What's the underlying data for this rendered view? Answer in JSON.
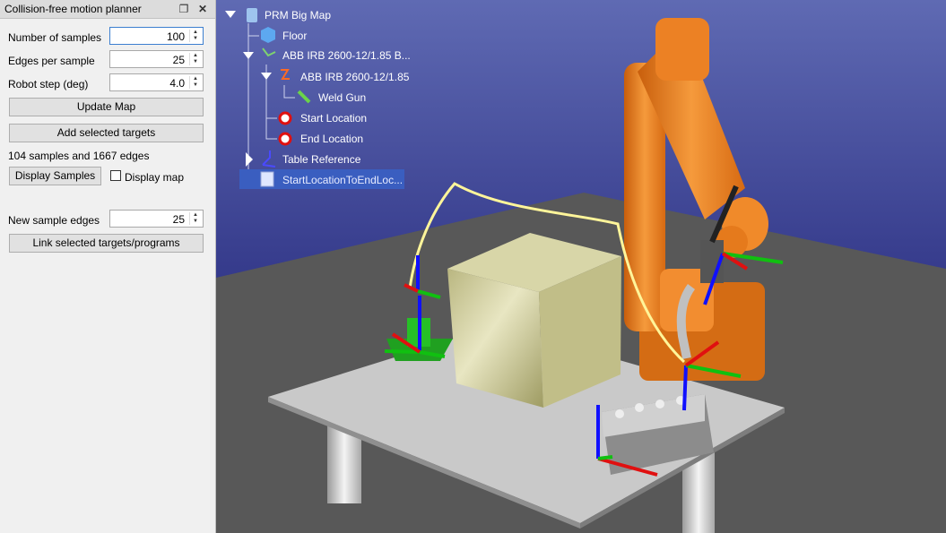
{
  "panel": {
    "title": "Collision-free motion planner",
    "float_icon": "float-icon",
    "close_icon": "close-icon",
    "fields": [
      {
        "label": "Number of samples",
        "value": "100"
      },
      {
        "label": "Edges per sample",
        "value": "25"
      },
      {
        "label": "Robot step (deg)",
        "value": "4.0"
      }
    ],
    "update_map_label": "Update Map",
    "add_targets_label": "Add selected targets",
    "status_text": "104 samples and 1667 edges",
    "display_samples_label": "Display Samples",
    "display_map_label": "Display map",
    "new_sample_edges_label": "New sample edges",
    "new_sample_edges_value": "25",
    "link_targets_label": "Link selected targets/programs"
  },
  "tree": {
    "root": "PRM Big Map",
    "floor": "Floor",
    "robot_group": "ABB IRB 2600-12/1.85 B...",
    "robot": "ABB IRB 2600-12/1.85",
    "tool": "Weld Gun",
    "start_target": "Start Location",
    "end_target": "End Location",
    "table_ref": "Table Reference",
    "program": "StartLocationToEndLoc..."
  },
  "colors": {
    "viewport_top": "#5f6ab3",
    "viewport_bottom": "#0e0e66",
    "robot": "#f07f1e",
    "box": "#c7c49a",
    "path": "#fff59a",
    "selection": "#3a5ec0"
  }
}
